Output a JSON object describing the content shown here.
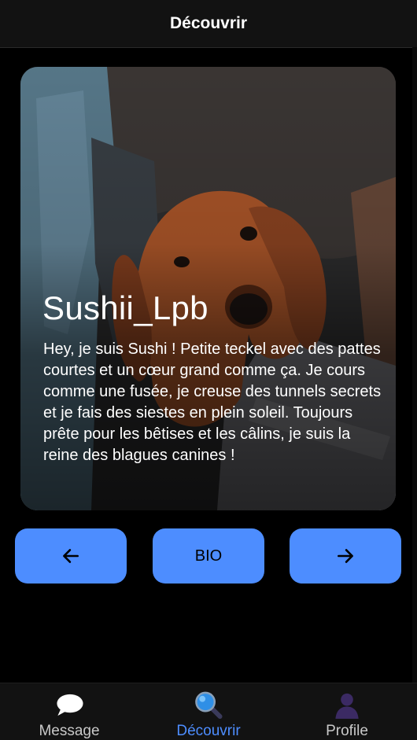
{
  "header": {
    "title": "Découvrir"
  },
  "profile_card": {
    "name": "Sushii_Lpb",
    "bio": "Hey, je suis Sushi ! Petite teckel avec des pattes courtes et un cœur grand comme ça. Je cours comme une fusée, je creuse des tunnels secrets et je fais des siestes en plein soleil. Toujours prête pour les bêtises et les câlins, je suis la reine des blagues canines !",
    "photo_icon": "dachshund-photo"
  },
  "actions": {
    "prev_icon": "arrow-left-icon",
    "bio_label": "BIO",
    "next_icon": "arrow-right-icon"
  },
  "tabs": [
    {
      "label": "Message",
      "icon": "speech-bubble-icon",
      "active": false
    },
    {
      "label": "Découvrir",
      "icon": "magnifier-icon",
      "active": true
    },
    {
      "label": "Profile",
      "icon": "person-icon",
      "active": false
    }
  ],
  "colors": {
    "accent": "#4d8dff",
    "background": "#000000",
    "bar": "#121212"
  }
}
